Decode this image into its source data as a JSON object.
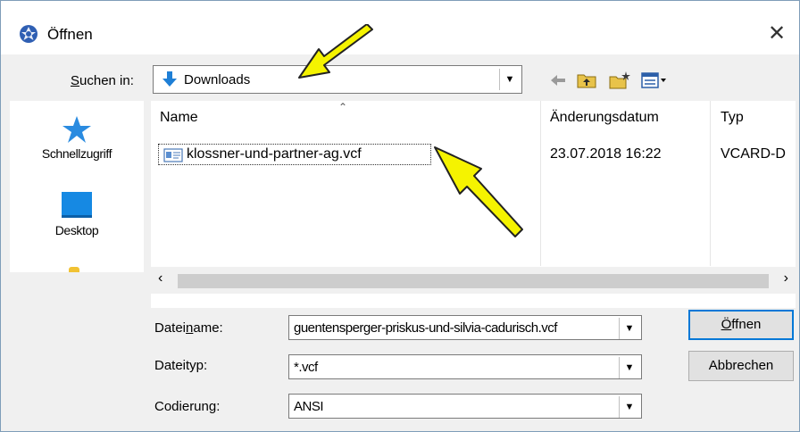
{
  "window": {
    "title": "Öffnen",
    "close_glyph": "✕"
  },
  "look_in": {
    "label": "Suchen in:",
    "underline": "S",
    "rest": "uchen in:",
    "value": "Downloads",
    "icon": "download-arrow-icon"
  },
  "toolbar": {
    "icons": [
      "back-arrow-icon",
      "up-folder-icon",
      "new-folder-icon",
      "view-menu-icon"
    ]
  },
  "places": [
    {
      "label": "Schnellzugriff",
      "icon": "star-icon"
    },
    {
      "label": "Desktop",
      "icon": "desktop-icon"
    }
  ],
  "columns": {
    "name": "Name",
    "date": "Änderungsdatum",
    "type": "Typ"
  },
  "files": [
    {
      "name": "klossner-und-partner-ag.vcf",
      "date": "23.07.2018 16:22",
      "type": "VCARD-D"
    }
  ],
  "fields": {
    "filename": {
      "label_pre": "Datei",
      "label_u": "n",
      "label_post": "ame:",
      "value": "guentensperger-priskus-und-silvia-cadurisch.vcf"
    },
    "filetype": {
      "label": "Dateityp:",
      "value": "*.vcf"
    },
    "encoding": {
      "label": "Codierung:",
      "value": "ANSI"
    }
  },
  "buttons": {
    "open_u": "Ö",
    "open_rest": "ffnen",
    "cancel": "Abbrechen"
  },
  "colors": {
    "accent": "#0078d7",
    "annotation_arrow": "#f5f300"
  }
}
